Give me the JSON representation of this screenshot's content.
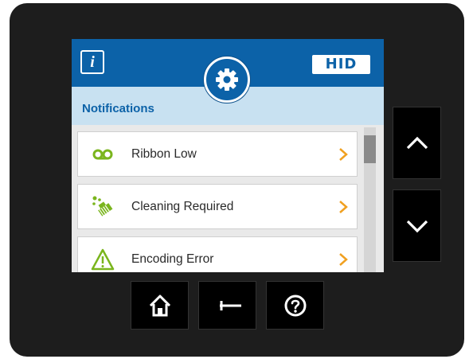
{
  "header": {
    "info_label": "i",
    "brand": "HID",
    "settings_icon": "gear-icon"
  },
  "section": {
    "title": "Notifications"
  },
  "notifications": [
    {
      "label": "Ribbon Low",
      "icon": "ribbon-icon",
      "icon_color": "#7ab51d"
    },
    {
      "label": "Cleaning Required",
      "icon": "cleaning-icon",
      "icon_color": "#7ab51d"
    },
    {
      "label": "Encoding Error",
      "icon": "warning-icon",
      "icon_color": "#7ab51d"
    }
  ],
  "colors": {
    "accent": "#0c62a8",
    "chevron": "#f0a020",
    "header_bg": "#c8e1f1"
  },
  "side_buttons": [
    {
      "icon": "chevron-up-icon"
    },
    {
      "icon": "chevron-down-icon"
    }
  ],
  "bottom_buttons": [
    {
      "icon": "home-icon"
    },
    {
      "icon": "back-arrow-icon"
    },
    {
      "icon": "help-icon"
    }
  ]
}
